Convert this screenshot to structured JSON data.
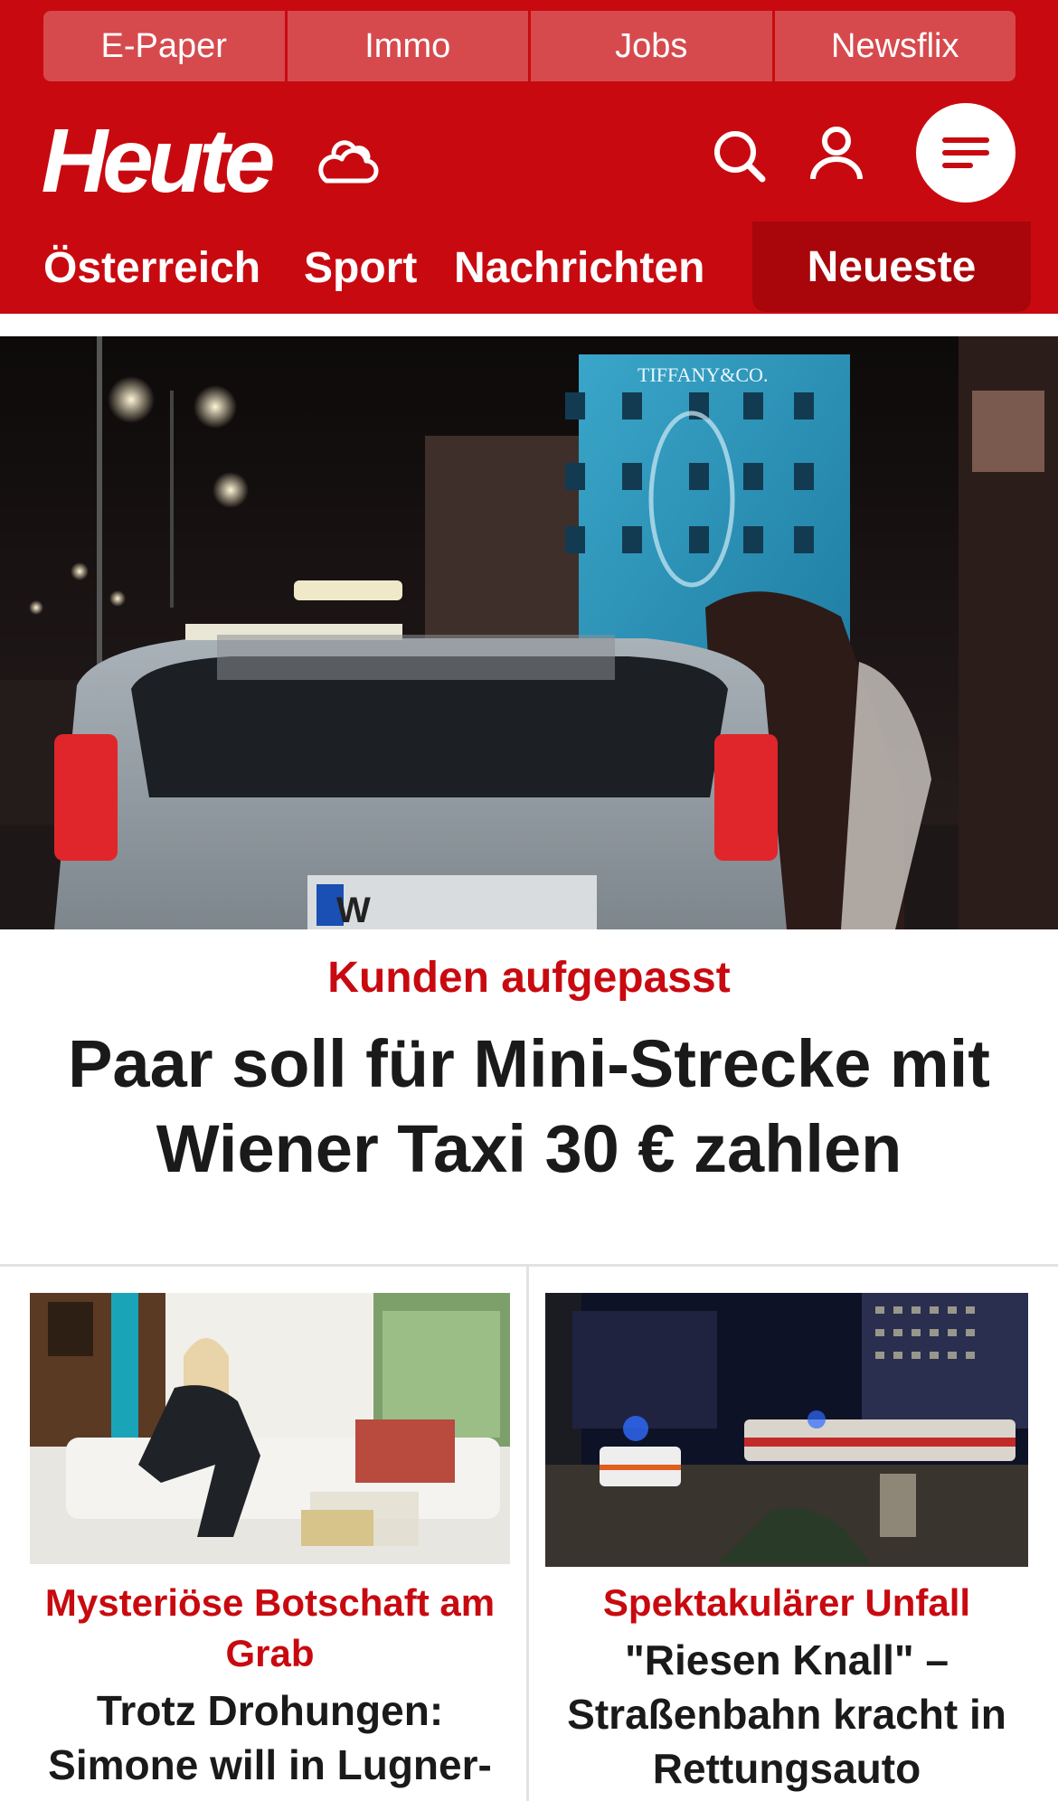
{
  "top_links": [
    "E-Paper",
    "Immo",
    "Jobs",
    "Newsflix"
  ],
  "header": {
    "logo": "Heute",
    "icons": {
      "weather": "weather-cloud-icon",
      "search": "search-icon",
      "account": "user-icon",
      "menu": "menu-icon"
    }
  },
  "nav": {
    "items": [
      "Österreich",
      "Sport",
      "Nachrichten"
    ],
    "highlight": "Neueste"
  },
  "hero": {
    "image_texts": {
      "building_sign": "TIFFANY&CO.",
      "plate": "W"
    },
    "kicker": "Kunden aufgepasst",
    "title": "Paar soll für Mini-Strecke mit Wiener Taxi 30 € zahlen"
  },
  "cards": [
    {
      "kicker": "Mysteriöse Botschaft am Grab",
      "title": "Trotz Drohungen: Simone will in Lugner-"
    },
    {
      "kicker": "Spektakulärer Unfall",
      "title": "\"Riesen Knall\" – Straßenbahn kracht in Rettungsauto"
    }
  ],
  "colors": {
    "brand_red": "#c80a10",
    "nav_highlight": "#a8060b",
    "top_link_bg": "#d64a4d",
    "text_dark": "#1a1a1a"
  }
}
